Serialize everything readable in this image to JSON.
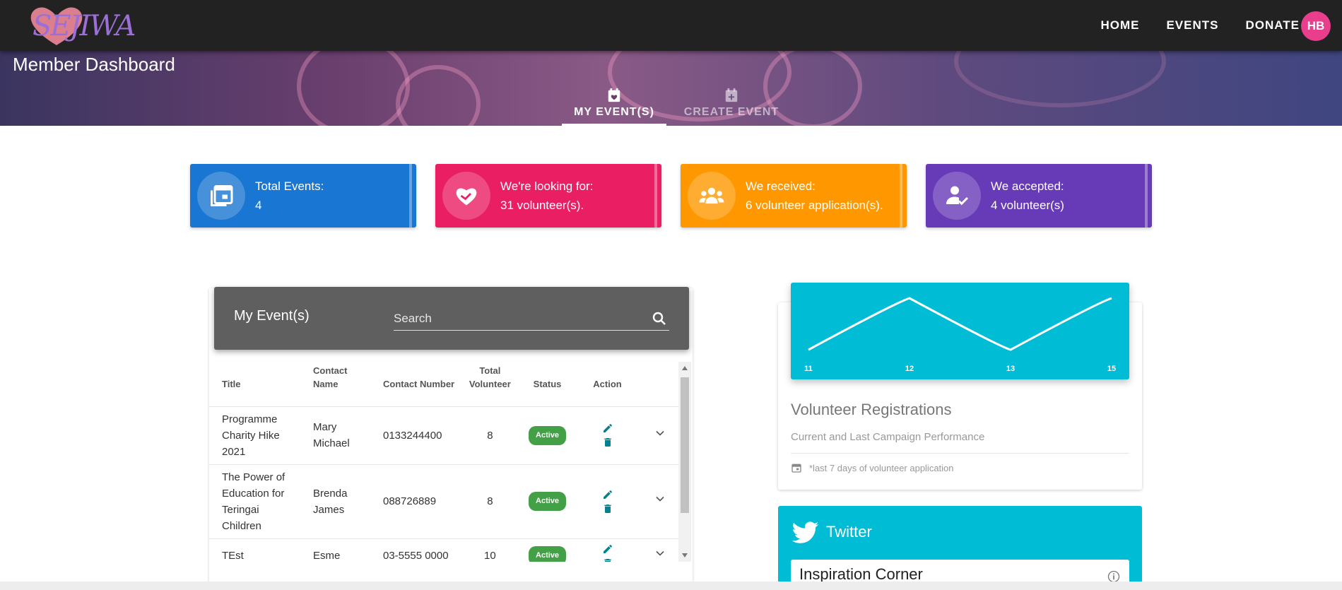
{
  "nav": {
    "logo_text": "SEJIWA",
    "links": [
      "HOME",
      "EVENTS",
      "DONATE"
    ],
    "avatar_initials": "HB"
  },
  "hero": {
    "title": "Member Dashboard",
    "tabs": [
      {
        "label": "MY EVENT(S)",
        "icon": "calendar-heart-icon",
        "active": true
      },
      {
        "label": "CREATE EVENT",
        "icon": "calendar-plus-icon",
        "active": false
      }
    ]
  },
  "stats": [
    {
      "label": "Total Events:",
      "value": "4",
      "color": "#1976d2",
      "icon": "calendar-stack-icon"
    },
    {
      "label": "We're looking for:",
      "value": "31 volunteer(s).",
      "color": "#e91e63",
      "icon": "heart-hand-icon"
    },
    {
      "label": "We received:",
      "value": "6 volunteer application(s).",
      "color": "#ff9800",
      "icon": "group-icon"
    },
    {
      "label": "We accepted:",
      "value": "4 volunteer(s)",
      "color": "#673ab7",
      "icon": "person-check-icon"
    }
  ],
  "events_panel": {
    "title": "My Event(s)",
    "search_placeholder": "Search",
    "columns": [
      "Title",
      "Contact Name",
      "Contact Number",
      "Total Volunteer",
      "Status",
      "Action"
    ],
    "rows": [
      {
        "title": "Programme Charity Hike 2021",
        "contact_name": "Mary Michael",
        "contact_number": "0133244400",
        "total": "8",
        "status": "Active"
      },
      {
        "title": "The Power of Education for Teringai Children",
        "contact_name": "Brenda James",
        "contact_number": "088726889",
        "total": "8",
        "status": "Active"
      },
      {
        "title": "TEst",
        "contact_name": "Esme",
        "contact_number": "03-5555 0000",
        "total": "10",
        "status": "Active"
      }
    ]
  },
  "chart_data": {
    "type": "line",
    "x": [
      "11",
      "12",
      "13",
      "15"
    ],
    "series": [
      {
        "values": [
          1,
          5,
          1,
          5
        ]
      }
    ],
    "title": "Volunteer Registrations",
    "subtitle": "Current and Last Campaign Performance",
    "footer": "*last 7 days of volunteer application",
    "line_color": "#ffffff",
    "background": "#00bcd4"
  },
  "twitter": {
    "title": "Twitter",
    "inner_title": "Inspiration Corner"
  }
}
